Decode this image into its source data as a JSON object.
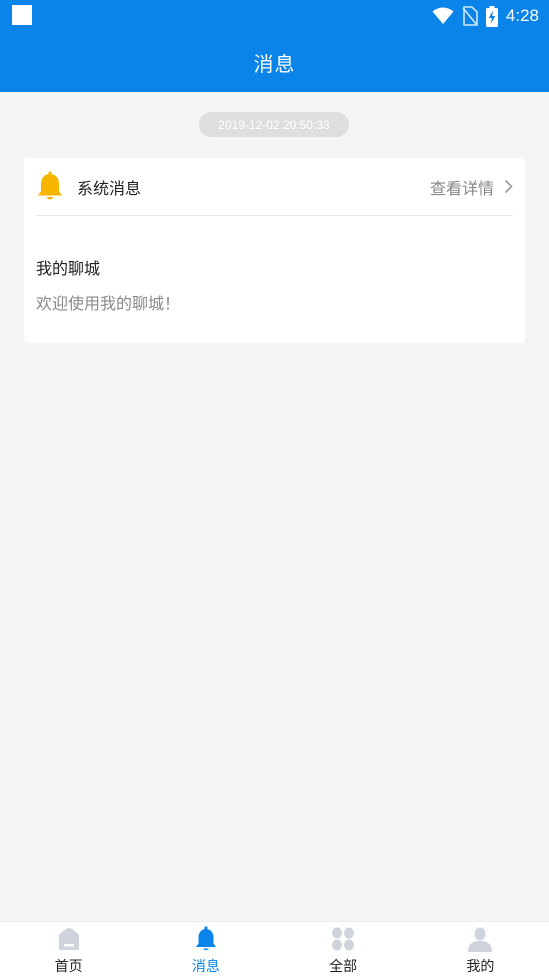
{
  "status_bar": {
    "time": "4:28",
    "icons": [
      "notification-square-icon",
      "wifi-icon",
      "no-sim-icon",
      "battery-charging-icon"
    ]
  },
  "header": {
    "title": "消息"
  },
  "timestamp": "2019-12-02 20:50:33",
  "message_card": {
    "icon": "bell-icon",
    "title": "系统消息",
    "detail_link": "查看详情",
    "message_title": "我的聊城",
    "message_body": "欢迎使用我的聊城！"
  },
  "bottom_nav": {
    "items": [
      {
        "label": "首页",
        "icon": "home-icon",
        "active": false
      },
      {
        "label": "消息",
        "icon": "bell-icon",
        "active": true
      },
      {
        "label": "全部",
        "icon": "grid-icon",
        "active": false
      },
      {
        "label": "我的",
        "icon": "user-icon",
        "active": false
      }
    ]
  },
  "colors": {
    "primary": "#0a84e8",
    "background": "#f4f4f4",
    "bell": "#f7b500",
    "inactive_icon": "#cfd3db"
  }
}
